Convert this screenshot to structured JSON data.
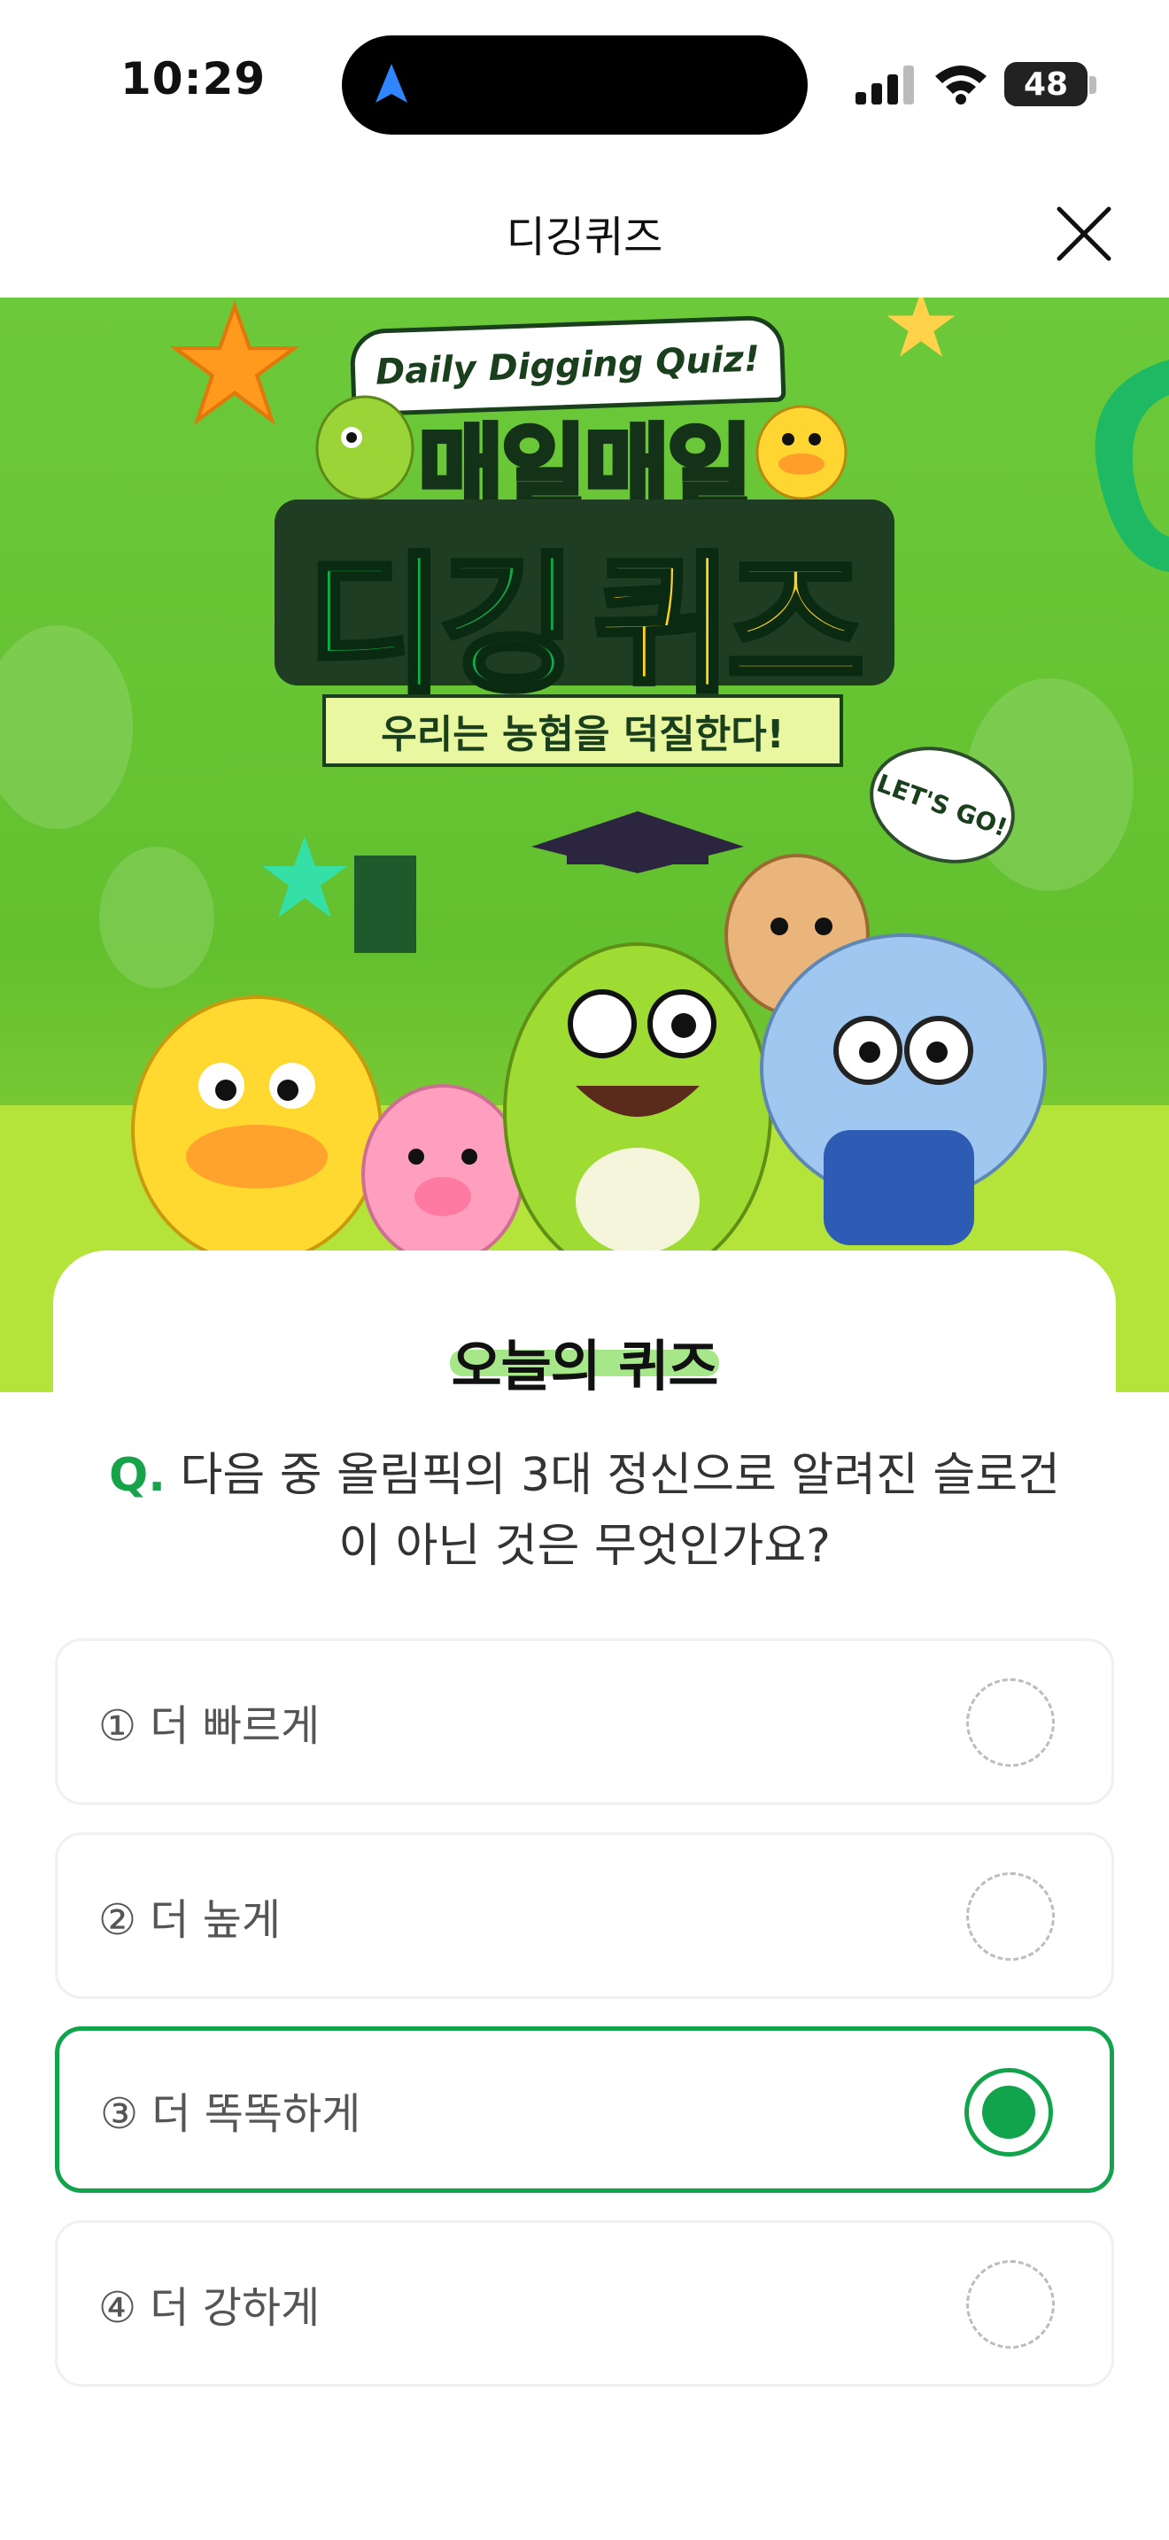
{
  "status_bar": {
    "time": "10:29",
    "battery": "48"
  },
  "header": {
    "title": "디깅퀴즈"
  },
  "banner": {
    "badge": "Daily Digging Quiz!",
    "title_line1": "매일매일",
    "title_line2_green": "디깅",
    "title_line2_yellow": "퀴즈",
    "subtitle": "우리는 농협을 덕질한다!",
    "bubble": "LET'S GO!"
  },
  "quiz": {
    "card_title": "오늘의 퀴즈",
    "question_mark": "Q.",
    "question": "다음 중 올림픽의 3대 정신으로 알려진 슬로건이 아닌 것은 무엇인가요?",
    "options": [
      {
        "label": "① 더 빠르게",
        "selected": false
      },
      {
        "label": "② 더 높게",
        "selected": false
      },
      {
        "label": "③ 더 똑똑하게",
        "selected": true
      },
      {
        "label": "④ 더 강하게",
        "selected": false
      }
    ]
  },
  "colors": {
    "accent": "#12a44d",
    "banner_green": "#6cc93a",
    "banner_floor": "#b4e33a"
  }
}
